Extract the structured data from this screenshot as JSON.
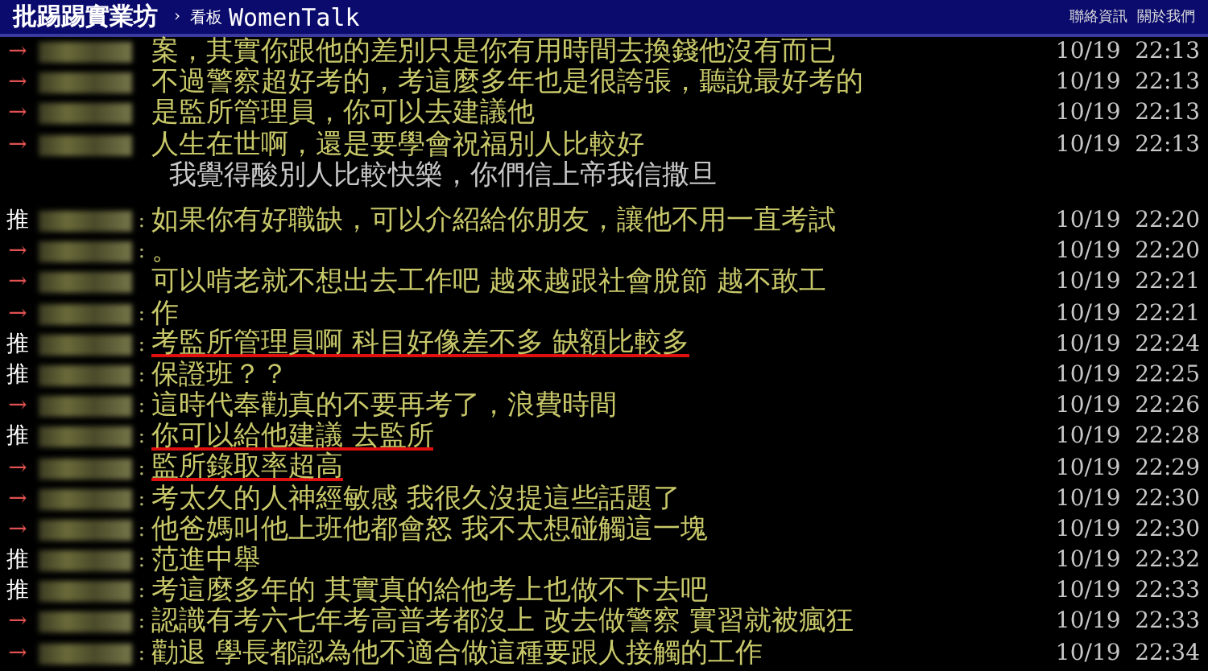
{
  "header": {
    "site": "批踢踢實業坊",
    "separator": "›",
    "board_label": "看板",
    "board": "WomenTalk",
    "links": [
      "聯絡資訊",
      "關於我們"
    ]
  },
  "lines": [
    {
      "kind": "arrow",
      "tag": "→",
      "text": "案，其實你跟他的差別只是你有用時間去換錢他沒有而已",
      "time": "10/19  22:13",
      "underlined": false
    },
    {
      "kind": "arrow",
      "tag": "→",
      "text": "不過警察超好考的，考這麼多年也是很誇張，聽說最好考的",
      "time": "10/19  22:13",
      "underlined": false
    },
    {
      "kind": "arrow",
      "tag": "→",
      "text": "是監所管理員，你可以去建議他",
      "time": "10/19  22:13",
      "underlined": false
    },
    {
      "kind": "arrow",
      "tag": "→",
      "text": "人生在世啊，還是要學會祝福別人比較好",
      "time": "10/19  22:13",
      "underlined": false
    },
    {
      "kind": "plain",
      "text": "我覺得酸別人比較快樂，你們信上帝我信撒旦"
    },
    {
      "kind": "blank"
    },
    {
      "kind": "push",
      "tag": "推",
      "colon": ":",
      "text": "如果你有好職缺，可以介紹給你朋友，讓他不用一直考試",
      "time": "10/19  22:20",
      "underlined": false
    },
    {
      "kind": "arrow",
      "tag": "→",
      "colon": ":",
      "text": "。",
      "time": "10/19  22:20",
      "underlined": false
    },
    {
      "kind": "arrow",
      "tag": "→",
      "text": "可以啃老就不想出去工作吧 越來越跟社會脫節 越不敢工",
      "time": "10/19  22:21",
      "underlined": false
    },
    {
      "kind": "arrow",
      "tag": "→",
      "colon": ":",
      "text": "作",
      "time": "10/19  22:21",
      "underlined": false
    },
    {
      "kind": "push",
      "tag": "推",
      "colon": ":",
      "text": "考監所管理員啊 科目好像差不多 缺額比較多",
      "time": "10/19  22:24",
      "underlined": true
    },
    {
      "kind": "push",
      "tag": "推",
      "colon": ":",
      "text": "保證班？？",
      "time": "10/19  22:25",
      "underlined": false
    },
    {
      "kind": "arrow",
      "tag": "→",
      "colon": ":",
      "text": "這時代奉勸真的不要再考了，浪費時間",
      "time": "10/19  22:26",
      "underlined": false
    },
    {
      "kind": "push",
      "tag": "推",
      "colon": ":",
      "text": "你可以給他建議 去監所",
      "time": "10/19  22:28",
      "underlined": true
    },
    {
      "kind": "arrow",
      "tag": "→",
      "colon": ":",
      "text": "監所錄取率超高",
      "time": "10/19  22:29",
      "underlined": true
    },
    {
      "kind": "arrow",
      "tag": "→",
      "colon": ":",
      "text": "考太久的人神經敏感 我很久沒提這些話題了",
      "time": "10/19  22:30",
      "underlined": false
    },
    {
      "kind": "arrow",
      "tag": "→",
      "colon": ":",
      "text": "他爸媽叫他上班他都會怒 我不太想碰觸這一塊",
      "time": "10/19  22:30",
      "underlined": false
    },
    {
      "kind": "push",
      "tag": "推",
      "colon": ":",
      "text": "范進中舉",
      "time": "10/19  22:32",
      "underlined": false
    },
    {
      "kind": "push",
      "tag": "推",
      "colon": ":",
      "text": "考這麼多年的 其實真的給他考上也做不下去吧",
      "time": "10/19  22:33",
      "underlined": false
    },
    {
      "kind": "arrow",
      "tag": "→",
      "colon": ":",
      "text": "認識有考六七年考高普考都沒上 改去做警察 實習就被瘋狂",
      "time": "10/19  22:33",
      "underlined": false
    },
    {
      "kind": "arrow",
      "tag": "→",
      "colon": ":",
      "text": "勸退 學長都認為他不適合做這種要跟人接觸的工作",
      "time": "10/19  22:34",
      "underlined": false
    }
  ]
}
